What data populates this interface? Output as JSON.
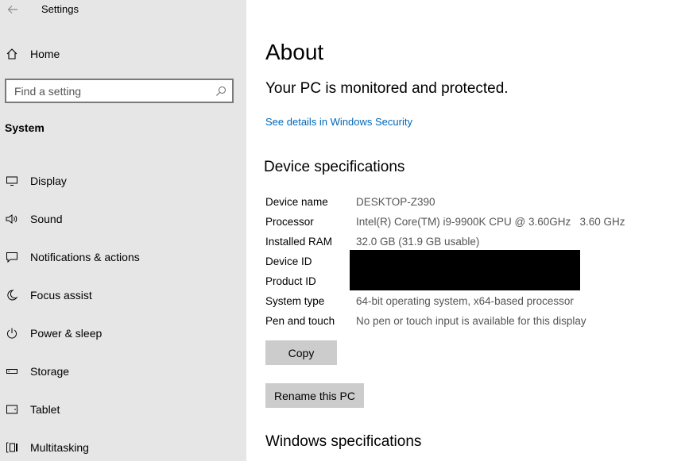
{
  "window": {
    "title": "Settings"
  },
  "sidebar": {
    "home_label": "Home",
    "search_placeholder": "Find a setting",
    "section_title": "System",
    "items": [
      {
        "label": "Display",
        "icon": "monitor-icon"
      },
      {
        "label": "Sound",
        "icon": "speaker-icon"
      },
      {
        "label": "Notifications & actions",
        "icon": "notification-icon"
      },
      {
        "label": "Focus assist",
        "icon": "moon-icon"
      },
      {
        "label": "Power & sleep",
        "icon": "power-icon"
      },
      {
        "label": "Storage",
        "icon": "storage-icon"
      },
      {
        "label": "Tablet",
        "icon": "tablet-icon"
      },
      {
        "label": "Multitasking",
        "icon": "multitasking-icon"
      }
    ]
  },
  "main": {
    "title": "About",
    "status": "Your PC is monitored and protected.",
    "security_link": "See details in Windows Security",
    "device_heading": "Device specifications",
    "specs": [
      {
        "label": "Device name",
        "value": "DESKTOP-Z390"
      },
      {
        "label": "Processor",
        "value": "Intel(R) Core(TM) i9-9900K CPU @ 3.60GHz   3.60 GHz"
      },
      {
        "label": "Installed RAM",
        "value": "32.0 GB (31.9 GB usable)"
      },
      {
        "label": "Device ID",
        "value": ""
      },
      {
        "label": "Product ID",
        "value": ""
      },
      {
        "label": "System type",
        "value": "64-bit operating system, x64-based processor"
      },
      {
        "label": "Pen and touch",
        "value": "No pen or touch input is available for this display"
      }
    ],
    "copy_label": "Copy",
    "rename_label": "Rename this PC",
    "windows_heading": "Windows specifications"
  },
  "colors": {
    "sidebar_bg": "#e6e6e6",
    "link": "#0067b8",
    "button_bg": "#cccccc"
  }
}
